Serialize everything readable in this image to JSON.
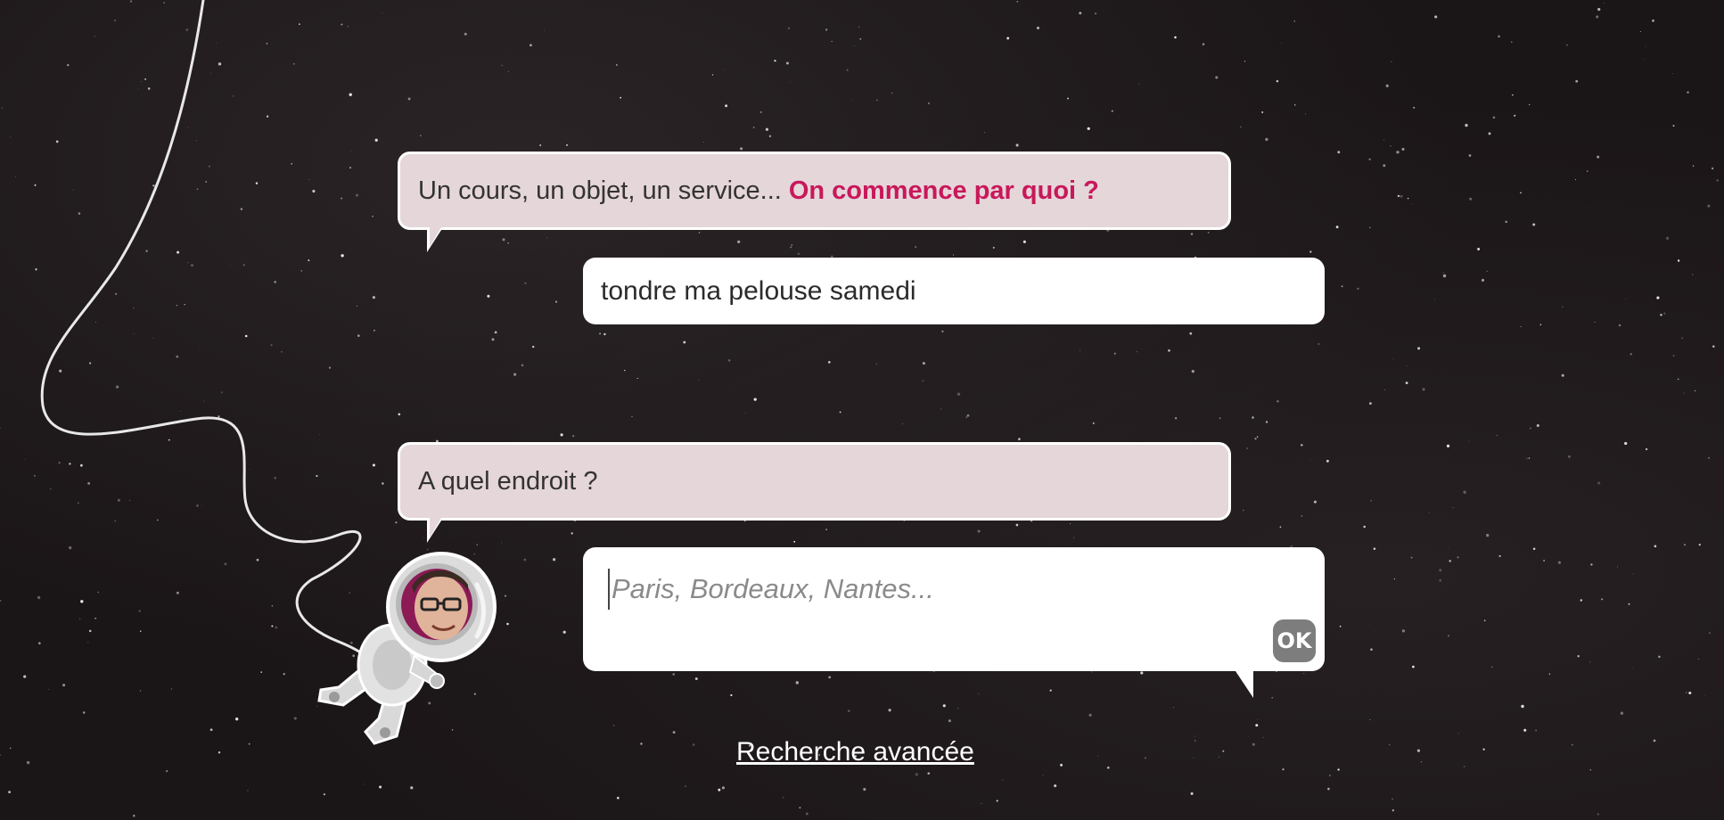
{
  "conversation": {
    "question_1": {
      "intro": "Un cours, un objet, un service...",
      "highlight": "On commence par quoi ?"
    },
    "answer_1": "tondre ma pelouse samedi",
    "question_2": {
      "text": "A quel endroit ?"
    },
    "location_input": {
      "placeholder": "Paris, Bordeaux, Nantes...",
      "value": ""
    },
    "ok_label": "OK"
  },
  "footer": {
    "advanced_search_label": "Recherche avancée"
  },
  "colors": {
    "accent": "#c8185a",
    "question_bubble": "#e5d6d9",
    "answer_bubble": "#ffffff",
    "ok_button": "#7d7d7d",
    "background": "#1a1517"
  },
  "icons": {
    "mascot": "astronaut-mascot-icon"
  }
}
